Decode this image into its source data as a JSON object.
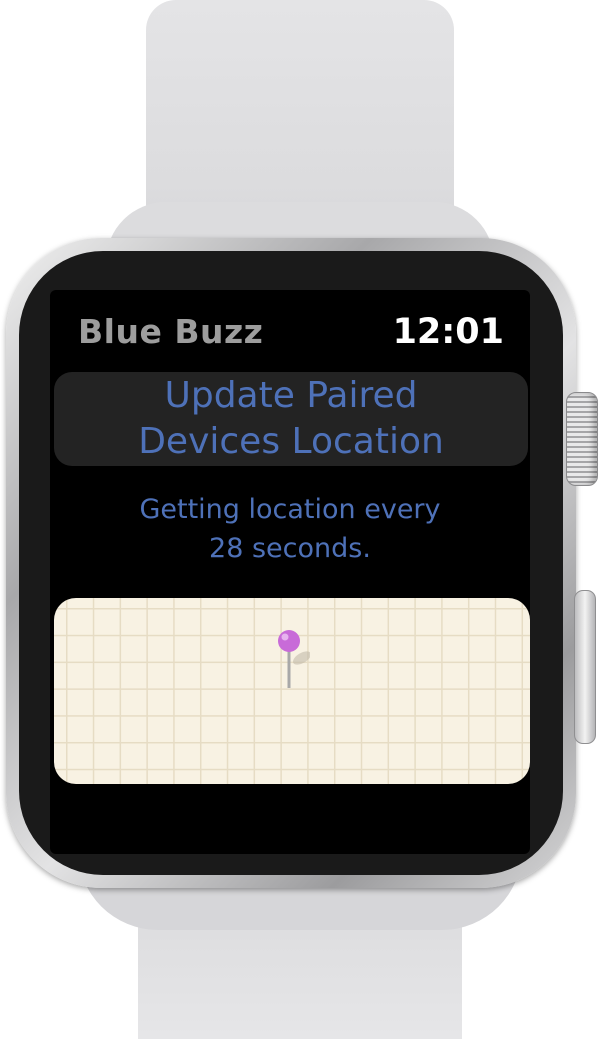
{
  "watch": {
    "app_title": "Blue Buzz",
    "time": "12:01"
  },
  "main": {
    "action_button_label": "Update Paired\nDevices Location",
    "status_message": "Getting location every\n28 seconds."
  },
  "map": {
    "pin_icon": "map-pin-icon",
    "pin_color": "#c86bd8"
  },
  "colors": {
    "accent_text": "#4e71b8",
    "title_text": "#9d9d9d",
    "clock_text": "#ffffff",
    "screen_bg": "#000000",
    "button_bg": "#232323",
    "map_bg": "#f8f2e3",
    "band": "#dcdcde"
  }
}
